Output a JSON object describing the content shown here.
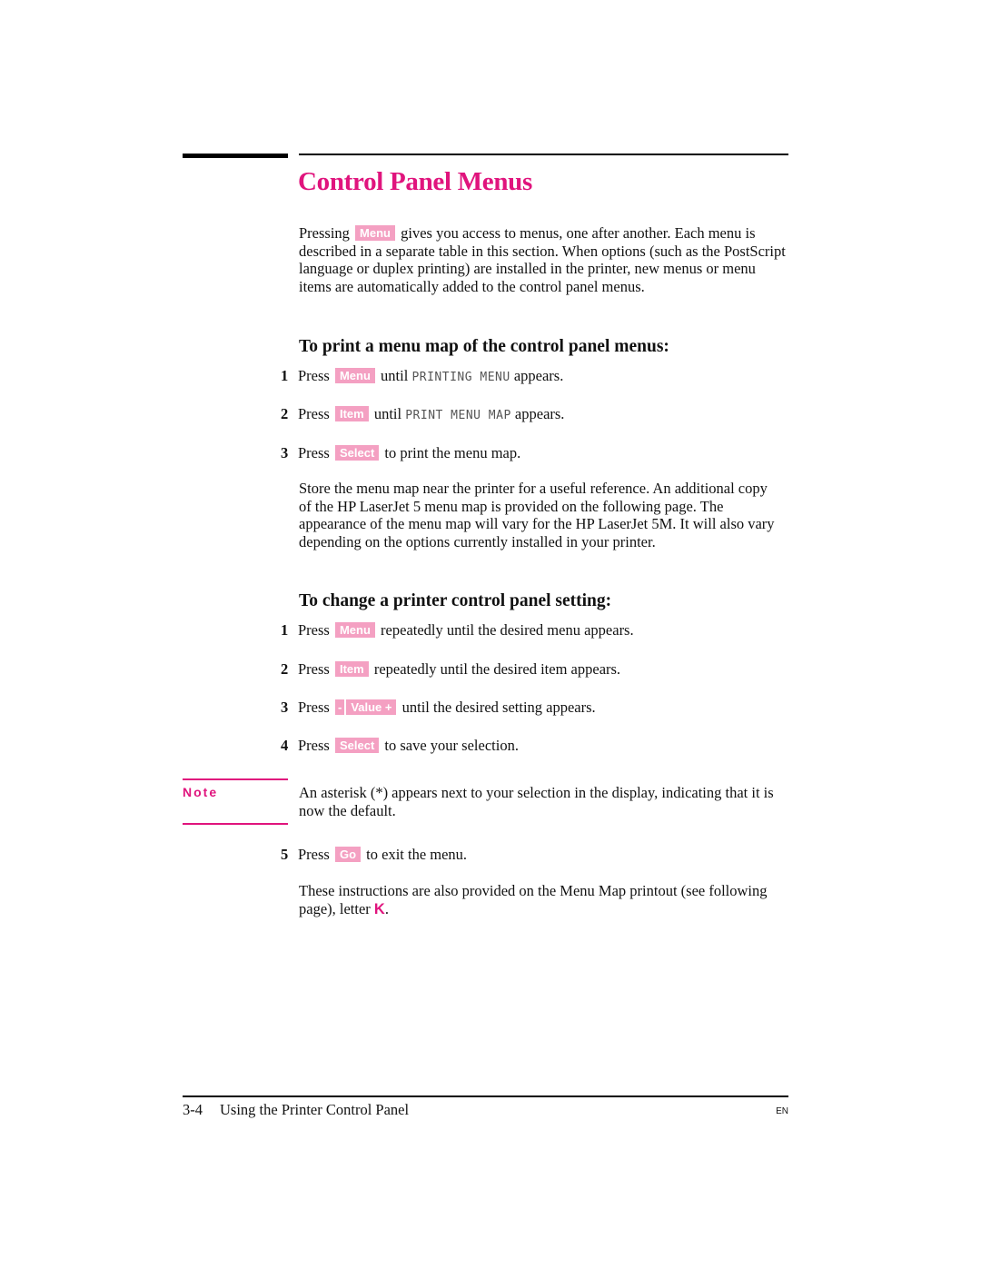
{
  "page": {
    "title": "Control Panel Menus",
    "accent_color": "#e0147d",
    "key_color": "#f4a0c2"
  },
  "intro": {
    "before": "Pressing",
    "key": "Menu",
    "after": "gives you access to menus, one after another.  Each menu is described in a separate table in this section.  When options (such as the PostScript language or duplex printing) are installed in the printer, new menus or menu items are automatically added to the control panel menus."
  },
  "section1": {
    "heading": "To print a menu map of the control panel menus:",
    "steps": [
      {
        "num": "1",
        "press": "Press",
        "key": "Menu",
        "mid": "until",
        "lcd": "PRINTING MENU",
        "after": "appears."
      },
      {
        "num": "2",
        "press": "Press",
        "key": "Item",
        "mid": "until",
        "lcd": "PRINT MENU MAP",
        "after": "appears."
      },
      {
        "num": "3",
        "press": "Press",
        "key": "Select",
        "after": "to print the menu map."
      }
    ],
    "paragraph": "Store the menu map near the printer for a useful reference.  An additional copy of the HP LaserJet 5 menu map is provided on the following page.  The appearance of the menu map will vary for the HP LaserJet 5M.  It will also vary depending on the options currently installed in your printer."
  },
  "section2": {
    "heading": "To change a printer control panel setting:",
    "steps": [
      {
        "num": "1",
        "press": "Press",
        "key": "Menu",
        "after": "repeatedly until the desired menu appears."
      },
      {
        "num": "2",
        "press": "Press",
        "key": "Item",
        "after": "repeatedly until the desired item appears."
      },
      {
        "num": "3",
        "press": "Press",
        "key_minus": "-",
        "key": "Value +",
        "after": "until the desired setting appears."
      },
      {
        "num": "4",
        "press": "Press",
        "key": "Select",
        "after": "to save your selection."
      }
    ],
    "note": {
      "label": "Note",
      "text": "An asterisk (*) appears next to your selection in the display, indicating that it is now the default."
    },
    "step5": {
      "num": "5",
      "press": "Press",
      "key": "Go",
      "after": "to exit the menu."
    },
    "closing_before": "These instructions are also provided on the Menu Map printout (see following page), letter",
    "closing_letter": "K",
    "closing_after": "."
  },
  "footer": {
    "page_number": "3-4",
    "chapter": "Using the Printer Control Panel",
    "lang": "EN"
  }
}
